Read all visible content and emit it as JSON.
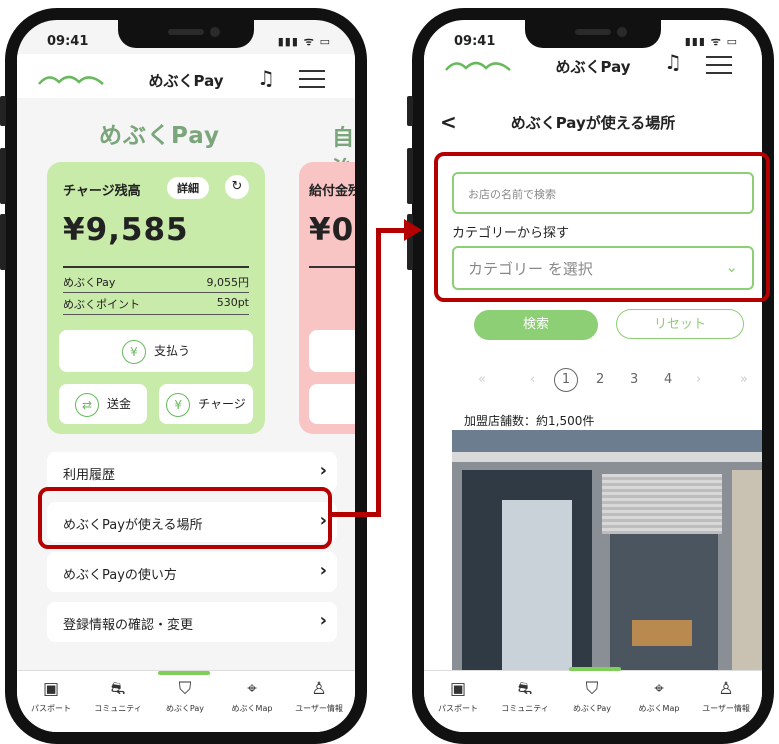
{
  "status": {
    "time": "09:41",
    "indicators": "▮▮▮ ᯤ ▭"
  },
  "left": {
    "header_title": "めぶくPay",
    "brand_title": "めぶくPay",
    "peek_title": "自治",
    "charge_card": {
      "label": "チャージ残高",
      "detail_button": "詳細",
      "refresh_icon": "↻",
      "balance": "¥9,585",
      "rows": [
        {
          "label": "めぶくPay",
          "value": "9,055円"
        },
        {
          "label": "めぶくポイント",
          "value": "530pt"
        }
      ],
      "pay_button": "支払う",
      "send_button": "送金",
      "charge_button": "チャージ"
    },
    "benefit_card": {
      "label": "給付金残",
      "balance": "¥0"
    },
    "links": [
      {
        "label": "利用履歴"
      },
      {
        "label": "めぶくPayが使える場所"
      },
      {
        "label": "めぶくPayの使い方"
      },
      {
        "label": "登録情報の確認・変更"
      }
    ]
  },
  "right": {
    "header_title": "めぶくPay",
    "page_title": "めぶくPayが使える場所",
    "back_icon": "<",
    "search_placeholder": "お店の名前で検索",
    "category_label": "カテゴリーから探す",
    "category_select": "カテゴリー を選択",
    "search_button": "検索",
    "reset_button": "リセット",
    "pagination": [
      "«",
      "‹",
      "1",
      "2",
      "3",
      "4",
      "›",
      "»"
    ],
    "store_count": "加盟店舗数：約1,500件"
  },
  "tabs": [
    {
      "icon": "passport-icon",
      "glyph": "▣",
      "label": "パスポート"
    },
    {
      "icon": "community-icon",
      "glyph": "⛐",
      "label": "コミュニティ"
    },
    {
      "icon": "pay-icon",
      "glyph": "⛉",
      "label": "めぶくPay"
    },
    {
      "icon": "map-icon",
      "glyph": "⌖",
      "label": "めぶくMap"
    },
    {
      "icon": "user-icon",
      "glyph": "♙",
      "label": "ユーザー情報"
    }
  ],
  "colors": {
    "accent_green": "#7fcf5a",
    "card_green": "#c9eba9",
    "card_pink": "#f8c4c4",
    "highlight_red": "#b40000"
  }
}
